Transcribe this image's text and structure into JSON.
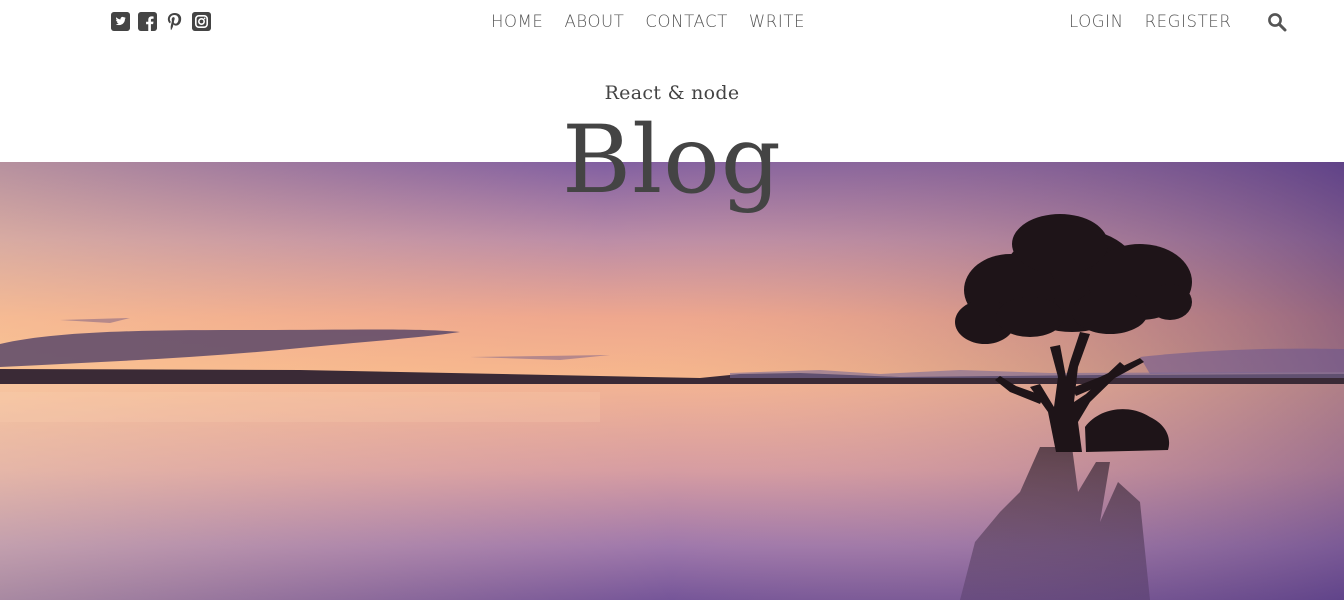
{
  "nav": {
    "social_icons": [
      "twitter-square-icon",
      "facebook-square-icon",
      "pinterest-icon",
      "instagram-square-icon"
    ],
    "center_links": [
      "HOME",
      "ABOUT",
      "CONTACT",
      "WRITE"
    ],
    "right_links": [
      "LOGIN",
      "REGISTER"
    ],
    "search_icon": "search-icon"
  },
  "header": {
    "subtitle": "React & node",
    "title": "Blog"
  },
  "hero": {
    "image": "sunset-lake-tree-photo",
    "colors": {
      "sky_top": "#7d5ba0",
      "sky_horizon": "#f6b48a",
      "water": "#b98fb0",
      "silhouette": "#1e1418"
    }
  }
}
